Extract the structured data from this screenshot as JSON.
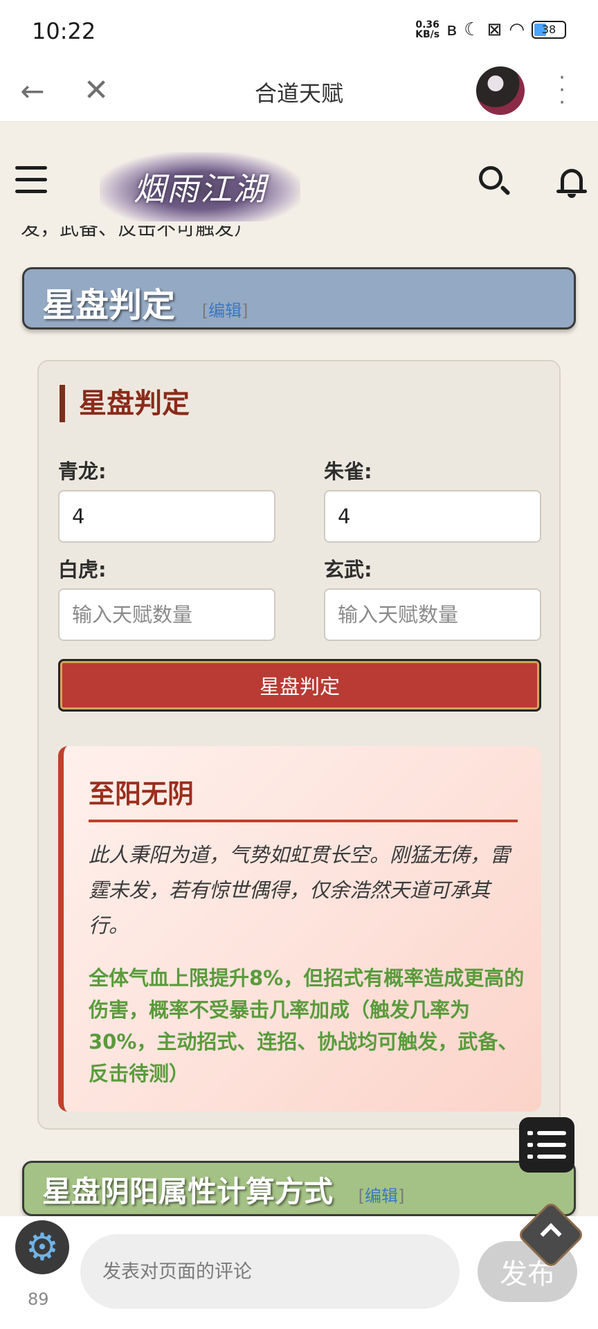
{
  "status_bar": {
    "time": "10:22",
    "net_speed_value": "0.36",
    "net_speed_unit": "KB/s",
    "battery": "38",
    "icons": [
      "bluetooth-icon",
      "moon-icon",
      "sim-off-icon",
      "wifi-icon",
      "battery-icon"
    ]
  },
  "toolbar": {
    "title": "合道天赋",
    "back_icon": "arrow-left-icon",
    "close_icon": "close-icon",
    "more_icon": "more-vertical-icon"
  },
  "site": {
    "logo_text": "烟雨江湖",
    "menu_icon": "hamburger-icon",
    "search_icon": "search-icon",
    "bell_icon": "bell-icon"
  },
  "cutoff_line": "发，武备、反击不可触发）",
  "section1": {
    "title": "星盘判定",
    "edit_open": "[",
    "edit_label": "编辑",
    "edit_close": "]"
  },
  "card": {
    "heading": "星盘判定",
    "fields": {
      "qinglong_label": "青龙:",
      "qinglong_value": "4",
      "zhuque_label": "朱雀:",
      "zhuque_value": "4",
      "baihu_label": "白虎:",
      "baihu_placeholder": "输入天赋数量",
      "xuanwu_label": "玄武:",
      "xuanwu_placeholder": "输入天赋数量"
    },
    "button_label": "星盘判定",
    "result": {
      "title": "至阳无阴",
      "description": "此人秉阳为道，气势如虹贯长空。刚猛无俦，雷霆未发，若有惊世偶得，仅余浩然天道可承其行。",
      "effect": "全体气血上限提升8%，但招式有概率造成更高的伤害，概率不受暴击几率加成（触发几率为30%，主动招式、连招、协战均可触发，武备、反击待测）"
    }
  },
  "section2": {
    "title": "星盘阴阳属性计算方式",
    "edit_open": "[",
    "edit_label": "编辑",
    "edit_close": "]"
  },
  "bottom_bar": {
    "gear_count": "89",
    "comment_placeholder": "发表对页面的评论",
    "publish_label": "发布"
  },
  "colors": {
    "page_bg": "#f3efe7",
    "section1_bar": "#94a9c3",
    "section2_bar": "#a4c285",
    "heading_red": "#8b2b1a",
    "button_red": "#b93b33",
    "effect_green": "#5a9b3c"
  }
}
